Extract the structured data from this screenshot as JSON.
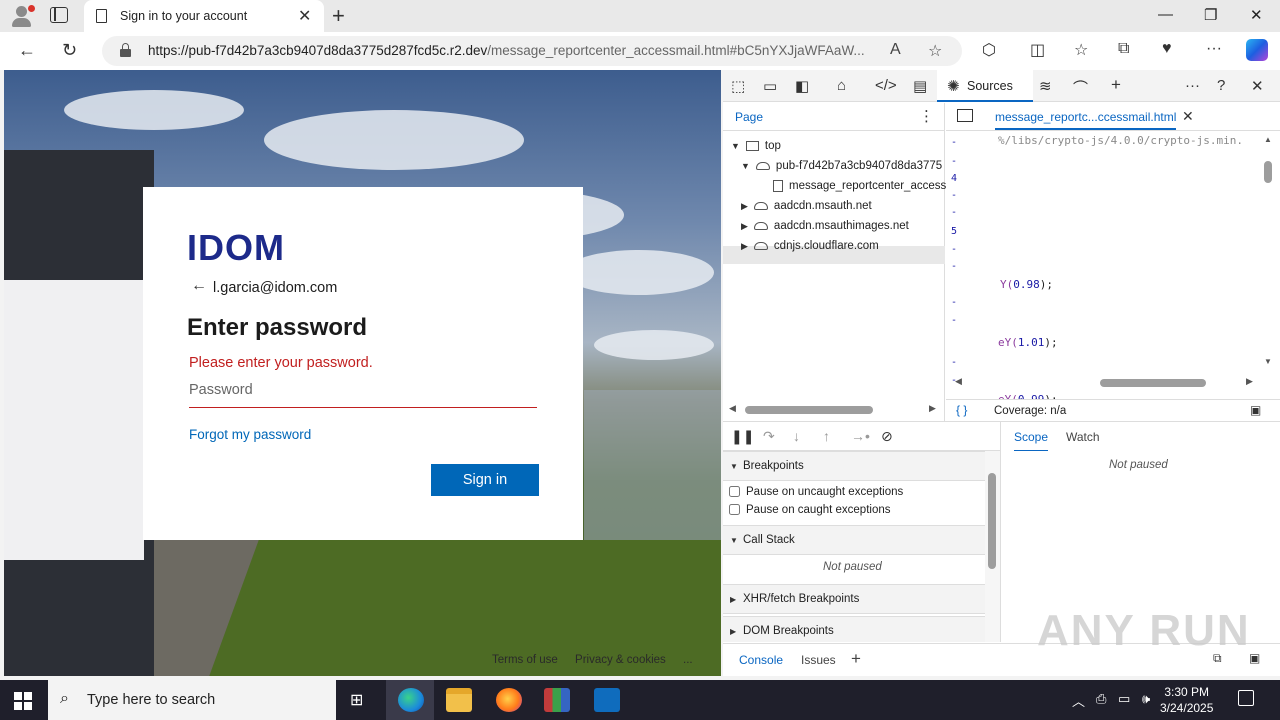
{
  "browser": {
    "tab_title": "Sign in to your account",
    "url_host": "https://pub-f7d42b7a3cb9407d8da3775d287fcd5c.r2.dev",
    "url_path": "/message_reportcenter_accessmail.html#bC5nYXJjaWFAaW..."
  },
  "signin": {
    "logo": "IDOM",
    "email": "l.garcia@idom.com",
    "heading": "Enter password",
    "error": "Please enter your password.",
    "password_placeholder": "Password",
    "forgot_label": "Forgot my password",
    "signin_label": "Sign in"
  },
  "page_footer": {
    "terms": "Terms of use",
    "privacy": "Privacy & cookies",
    "more": "..."
  },
  "devtools": {
    "sources_label": "Sources",
    "page_tab": "Page",
    "tree": {
      "top": "top",
      "host": "pub-f7d42b7a3cb9407d8da3775",
      "file": "message_reportcenter_access",
      "d1": "aadcdn.msauth.net",
      "d2": "aadcdn.msauthimages.net",
      "d3": "cdnjs.cloudflare.com"
    },
    "editor_tab": "message_reportc...ccessmail.html",
    "code": {
      "line_top": "%/libs/crypto-js/4.0.0/crypto-js.min.",
      "gutter_4": "4",
      "gutter_5": "5",
      "l1_fn": "Y(",
      "l1_num": "0.98",
      "l1_end": ");",
      "l2_fn": "eY(",
      "l2_num": "1.01",
      "l2_end": ");",
      "l3_fn": "eY(",
      "l3_num": "0.99",
      "l3_end": ");"
    },
    "coverage": "Coverage: n/a",
    "scope_tab": "Scope",
    "watch_tab": "Watch",
    "scope_not_paused": "Not paused",
    "breakpoints": "Breakpoints",
    "pause_uncaught": "Pause on uncaught exceptions",
    "pause_caught": "Pause on caught exceptions",
    "call_stack": "Call Stack",
    "call_stack_not_paused": "Not paused",
    "xhr_breakpoints": "XHR/fetch Breakpoints",
    "dom_breakpoints": "DOM Breakpoints",
    "console_tab": "Console",
    "issues_tab": "Issues"
  },
  "watermark": "ANY RUN",
  "taskbar": {
    "search_placeholder": "Type here to search",
    "time": "3:30 PM",
    "date": "3/24/2025"
  },
  "colors": {
    "accent": "#0067b8",
    "error": "#c11f1f",
    "logo": "#1d2a8a",
    "devtools_accent": "#0a66c2"
  }
}
